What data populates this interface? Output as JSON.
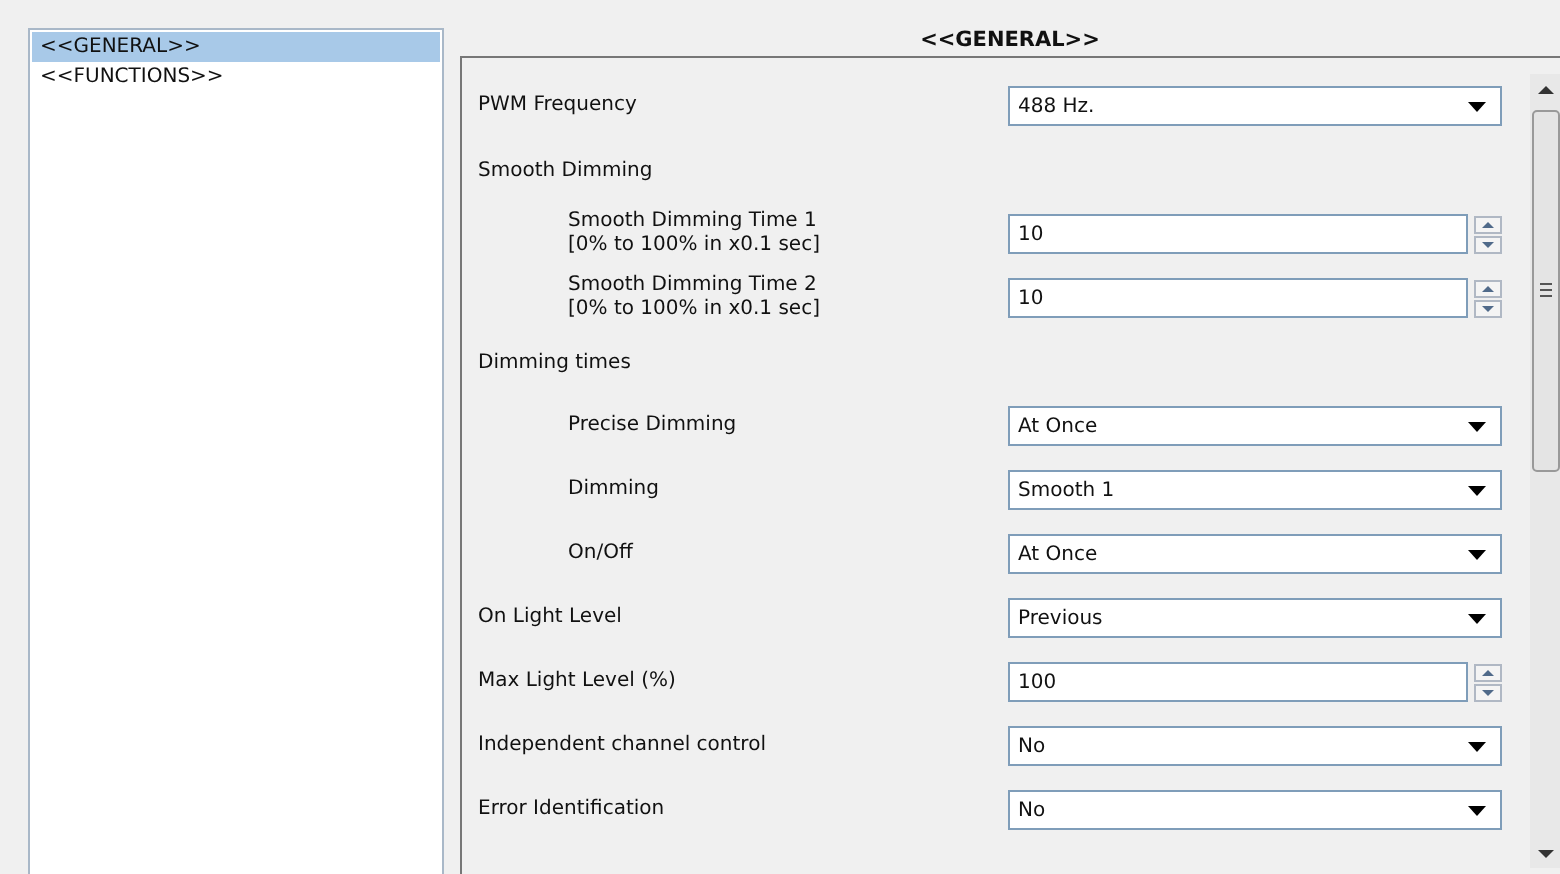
{
  "sidebar": {
    "items": [
      {
        "label": "<<GENERAL>>",
        "selected": true
      },
      {
        "label": "<<FUNCTIONS>>",
        "selected": false
      }
    ]
  },
  "page_title": "<<GENERAL>>",
  "parameters": [
    {
      "kind": "select",
      "label": "PWM Frequency",
      "value": "488 Hz."
    },
    {
      "kind": "heading",
      "label": "Smooth Dimming",
      "children": [
        {
          "kind": "spin",
          "label": "Smooth Dimming Time 1",
          "note": "[0% to 100% in x0.1 sec]",
          "value": "10"
        },
        {
          "kind": "spin",
          "label": "Smooth Dimming Time 2",
          "note": "[0% to 100% in x0.1 sec]",
          "value": "10"
        }
      ]
    },
    {
      "kind": "heading",
      "label": "Dimming times",
      "children": [
        {
          "kind": "select",
          "label": "Precise Dimming",
          "value": "At Once"
        },
        {
          "kind": "select",
          "label": "Dimming",
          "value": "Smooth 1"
        },
        {
          "kind": "select",
          "label": "On/Off",
          "value": "At Once"
        }
      ]
    },
    {
      "kind": "select",
      "label": "On Light Level",
      "value": "Previous"
    },
    {
      "kind": "spin",
      "label": "Max Light Level (%)",
      "value": "100"
    },
    {
      "kind": "select",
      "label": "Independent channel control",
      "value": "No"
    },
    {
      "kind": "select",
      "label": "Error Identification",
      "value": "No"
    }
  ]
}
